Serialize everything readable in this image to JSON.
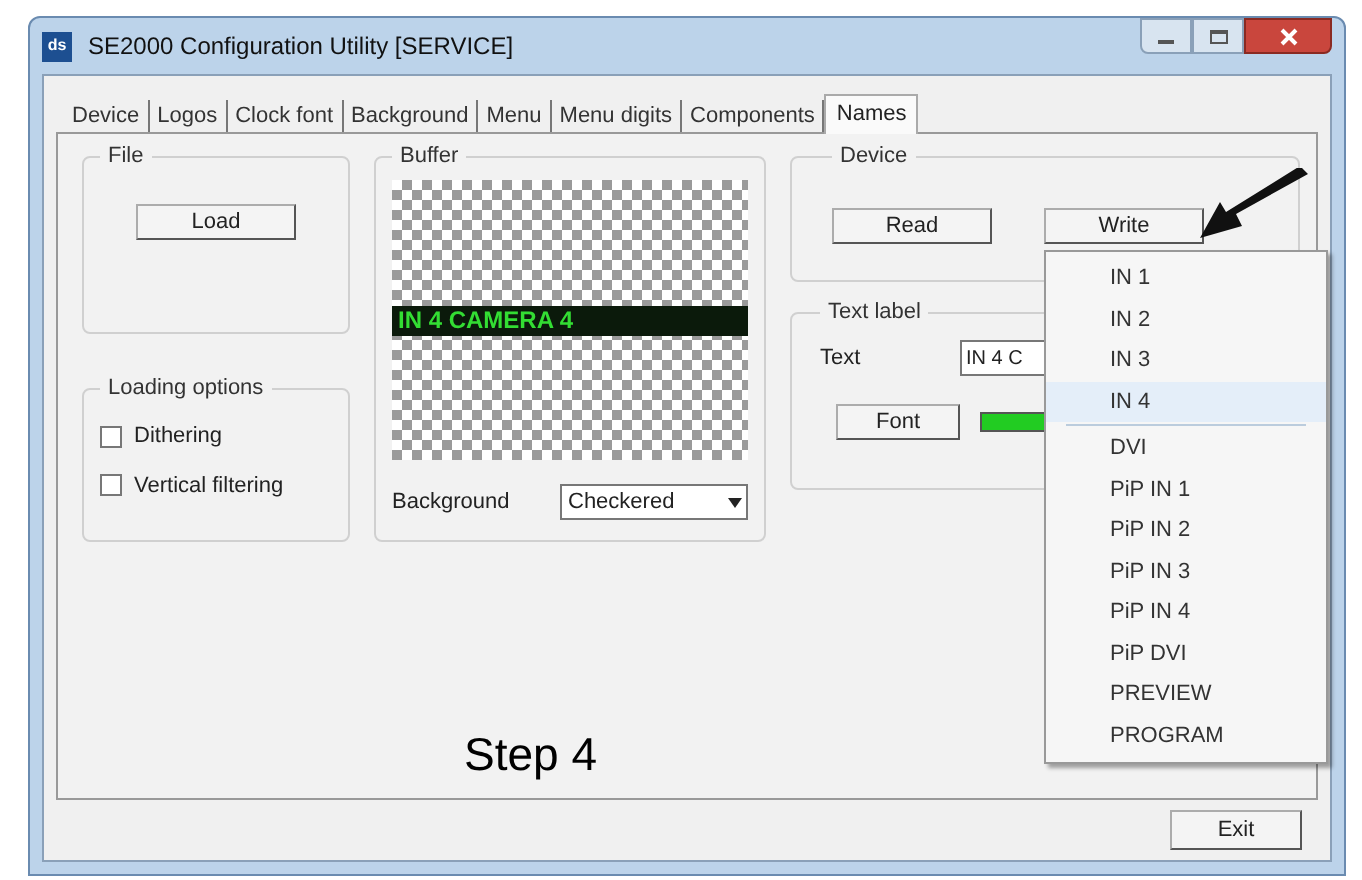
{
  "window": {
    "title": "SE2000 Configuration Utility [SERVICE]",
    "app_icon": "ds"
  },
  "tabs": [
    {
      "label": "Device",
      "selected": false
    },
    {
      "label": "Logos",
      "selected": false
    },
    {
      "label": "Clock font",
      "selected": false
    },
    {
      "label": "Background",
      "selected": false
    },
    {
      "label": "Menu",
      "selected": false
    },
    {
      "label": "Menu digits",
      "selected": false
    },
    {
      "label": "Components",
      "selected": false
    },
    {
      "label": "Names",
      "selected": true
    }
  ],
  "file_group": {
    "title": "File",
    "load_button": "Load"
  },
  "loading_options": {
    "title": "Loading options",
    "options": [
      {
        "label": "Dithering",
        "checked": false
      },
      {
        "label": "Vertical filtering",
        "checked": false
      }
    ]
  },
  "buffer": {
    "title": "Buffer",
    "preview_text": "IN 4 CAMERA 4",
    "background_label": "Background",
    "background_value": "Checkered"
  },
  "device": {
    "title": "Device",
    "read_button": "Read",
    "write_button": "Write"
  },
  "text_label": {
    "title": "Text label",
    "text_label": "Text",
    "text_value": "IN 4 C",
    "font_button": "Font"
  },
  "write_menu": [
    {
      "kind": "item",
      "label": "IN 1",
      "selected": false
    },
    {
      "kind": "item",
      "label": "IN 2",
      "selected": false
    },
    {
      "kind": "item",
      "label": "IN 3",
      "selected": false
    },
    {
      "kind": "item",
      "label": "IN 4",
      "selected": true
    },
    {
      "kind": "separator"
    },
    {
      "kind": "item",
      "label": "DVI",
      "selected": false
    },
    {
      "kind": "item",
      "label": "PiP IN 1",
      "selected": false
    },
    {
      "kind": "item",
      "label": "PiP IN 2",
      "selected": false
    },
    {
      "kind": "item",
      "label": "PiP IN 3",
      "selected": false
    },
    {
      "kind": "item",
      "label": "PiP IN 4",
      "selected": false
    },
    {
      "kind": "item",
      "label": "PiP DVI",
      "selected": false
    },
    {
      "kind": "item",
      "label": "PREVIEW",
      "selected": false
    },
    {
      "kind": "item",
      "label": "PROGRAM",
      "selected": false
    }
  ],
  "annotation": {
    "step": "Step 4"
  },
  "exit_button": "Exit"
}
